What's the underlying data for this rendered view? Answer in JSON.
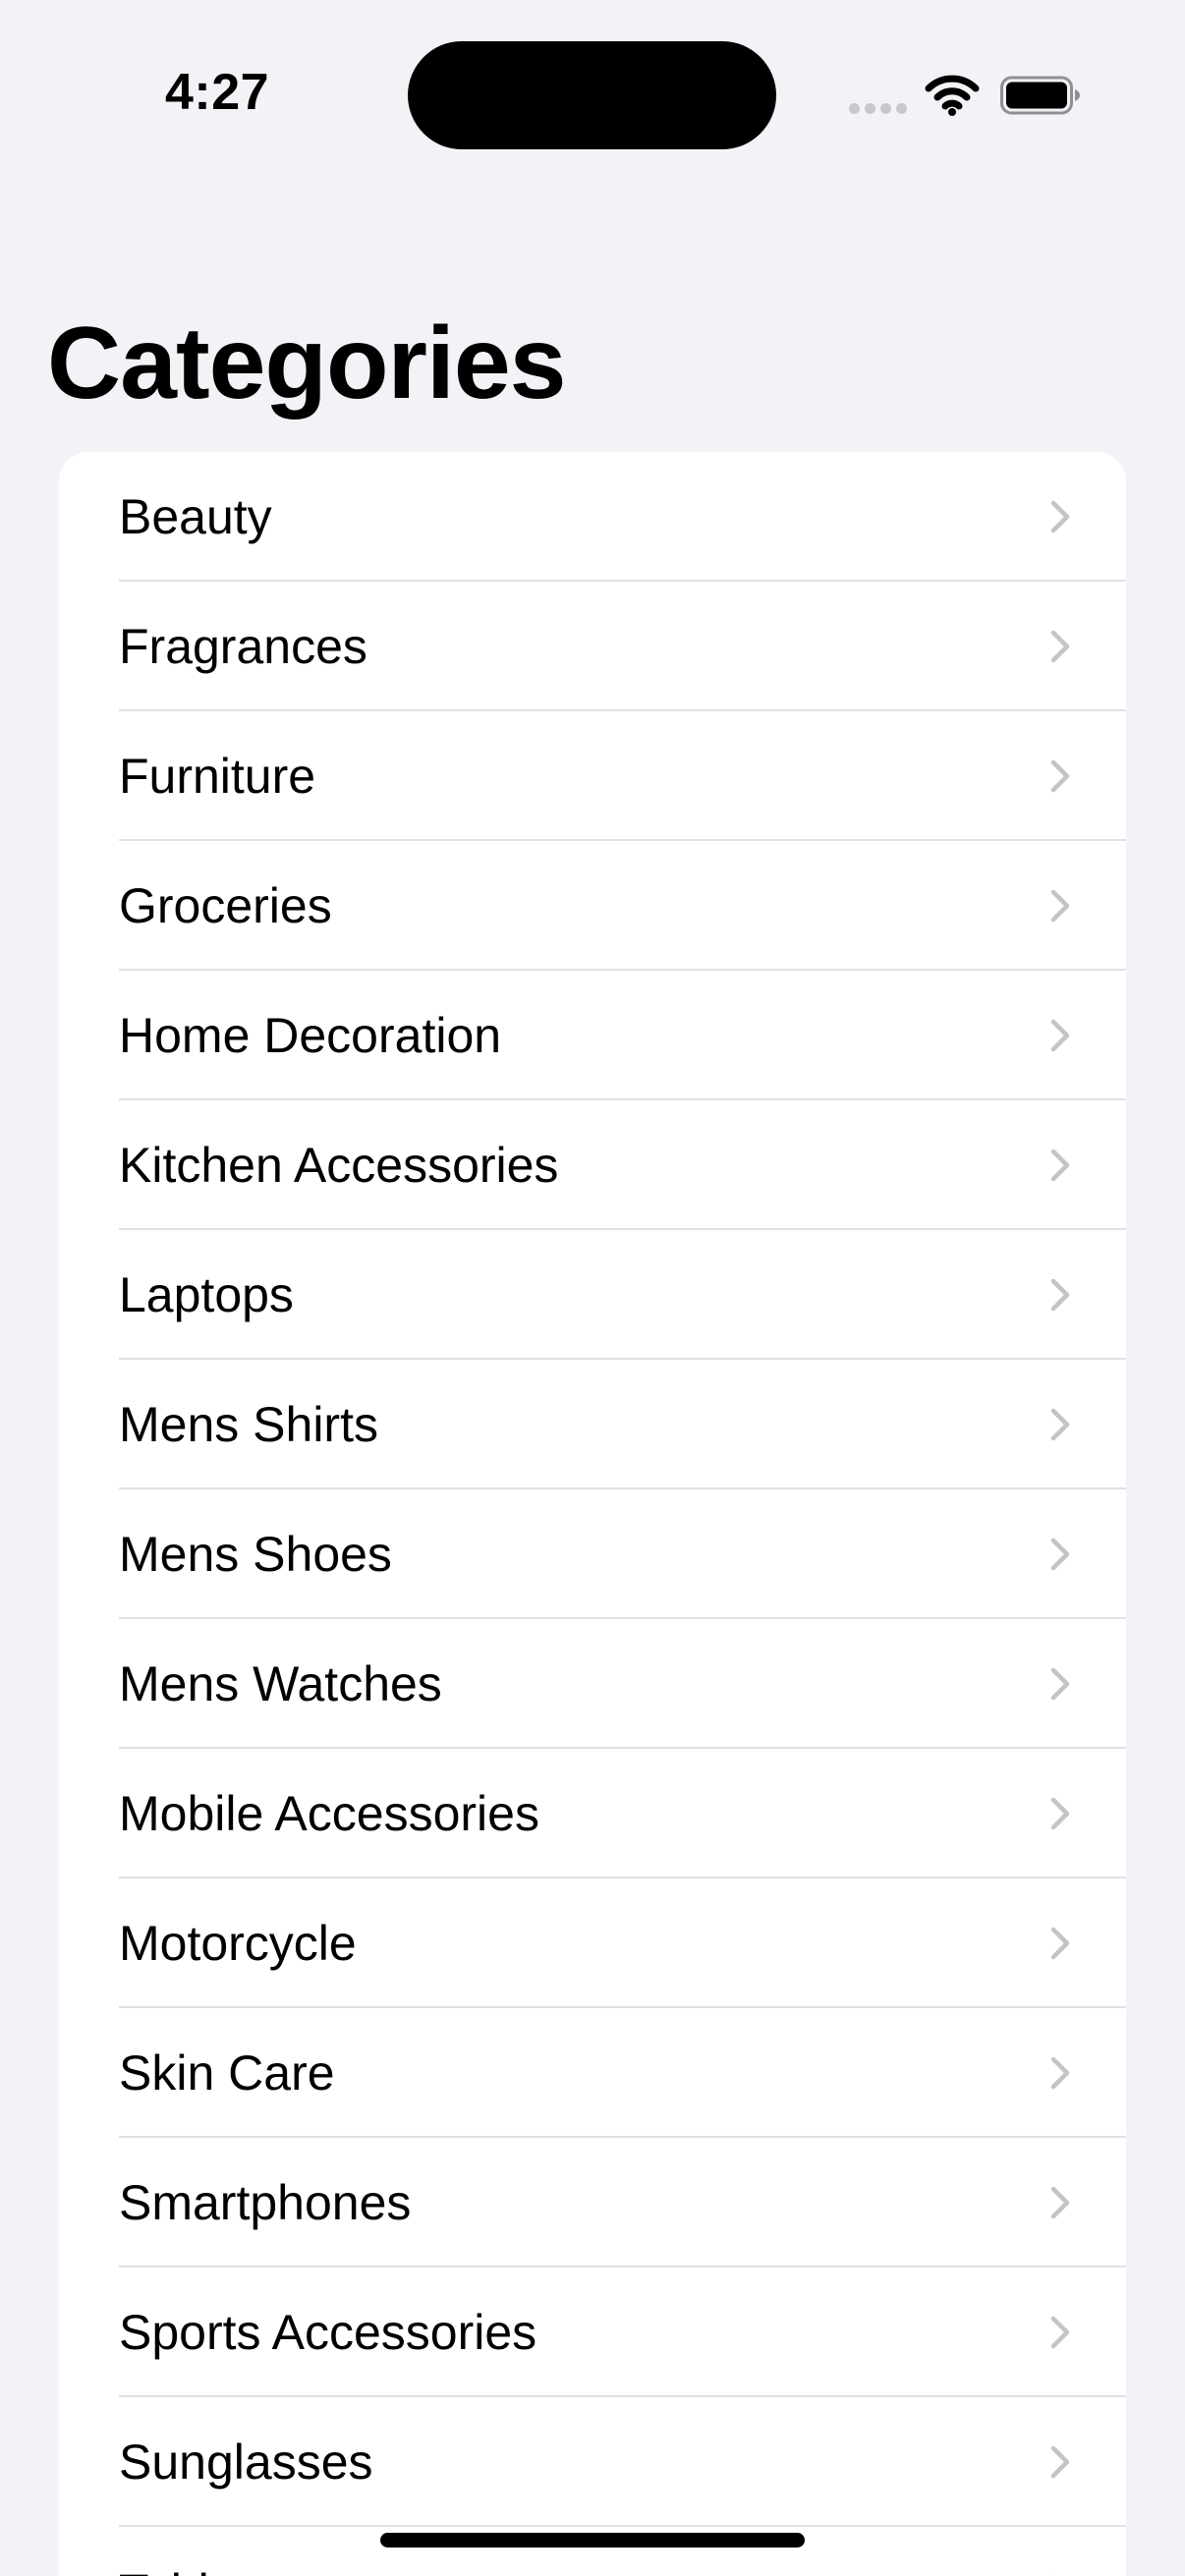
{
  "status_bar": {
    "time": "4:27"
  },
  "page": {
    "title": "Categories"
  },
  "categories": [
    "Beauty",
    "Fragrances",
    "Furniture",
    "Groceries",
    "Home Decoration",
    "Kitchen Accessories",
    "Laptops",
    "Mens Shirts",
    "Mens Shoes",
    "Mens Watches",
    "Mobile Accessories",
    "Motorcycle",
    "Skin Care",
    "Smartphones",
    "Sports Accessories",
    "Sunglasses",
    "Tablets"
  ],
  "icons": {
    "row_trailing": "chevron-right-icon",
    "status": [
      "cellular-signal-icon",
      "wifi-icon",
      "battery-icon"
    ]
  },
  "colors": {
    "background": "#f2f2f7",
    "card": "#ffffff",
    "separator": "#e0e0e5",
    "chevron": "#c4c4c7",
    "text": "#000000"
  }
}
